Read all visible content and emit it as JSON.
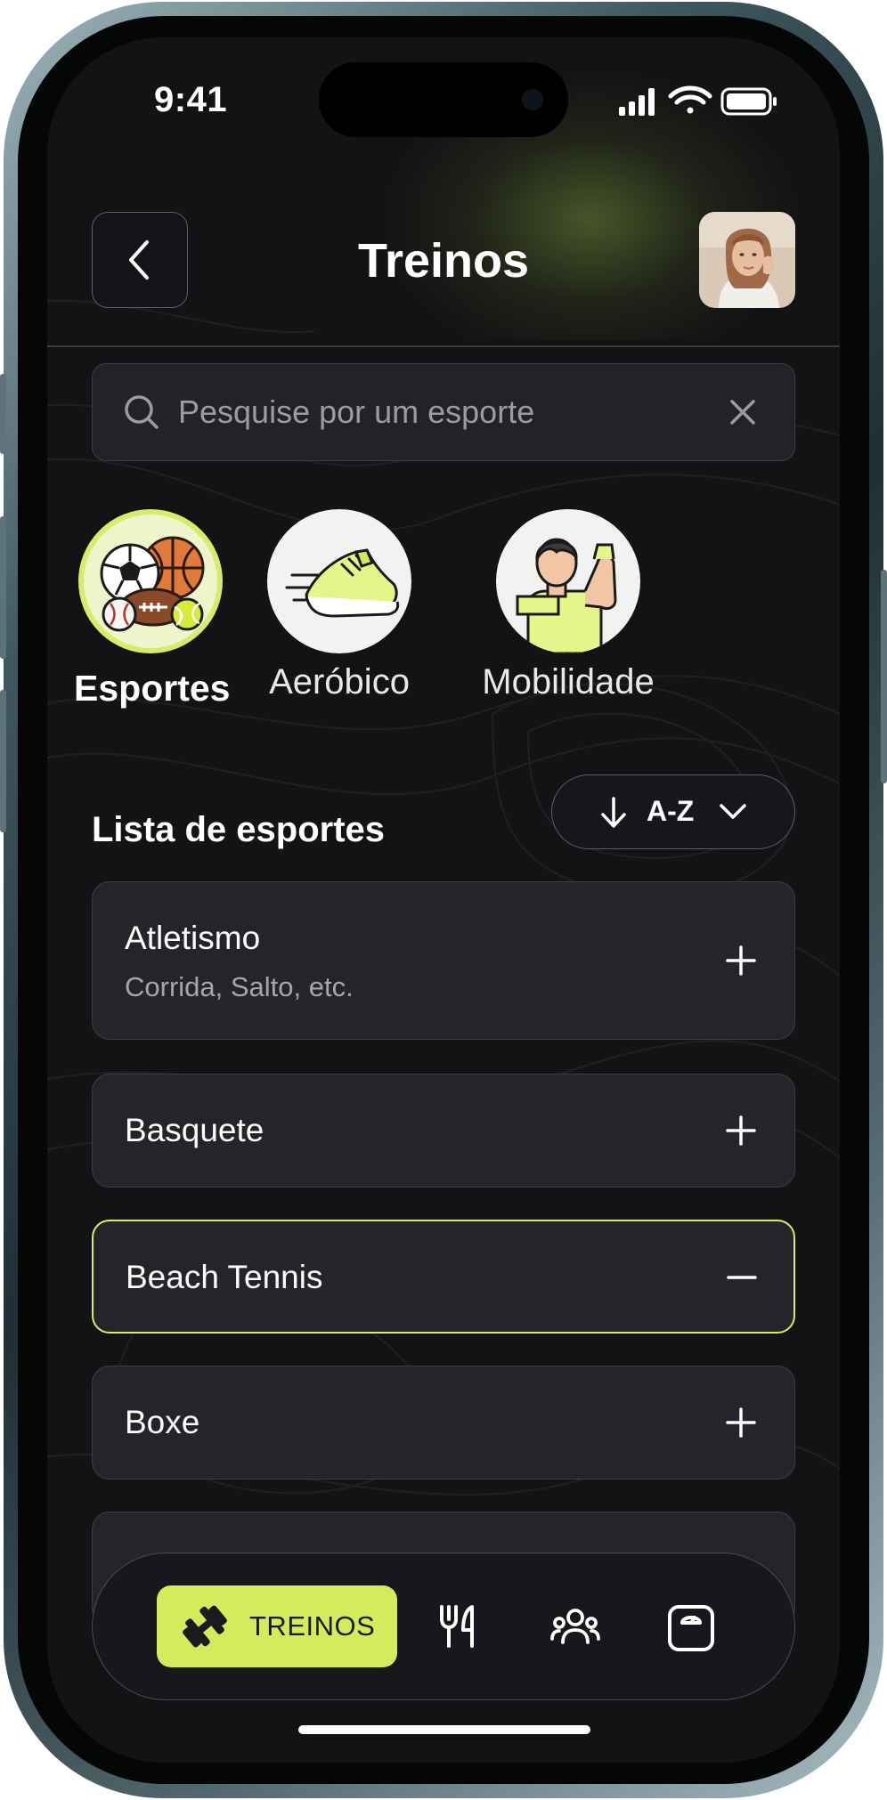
{
  "status_bar": {
    "time": "9:41"
  },
  "header": {
    "title": "Treinos",
    "back_icon": "chevron-left-icon",
    "avatar": "user-avatar-photo"
  },
  "search": {
    "placeholder": "Pesquise por um esporte",
    "value": "",
    "icon": "search-icon",
    "clear_icon": "close-icon"
  },
  "categories": [
    {
      "label": "Esportes",
      "icon": "sports-balls-icon",
      "active": true
    },
    {
      "label": "Aeróbico",
      "icon": "running-shoe-icon",
      "active": false
    },
    {
      "label": "Mobilidade",
      "icon": "stretching-person-icon",
      "active": false
    }
  ],
  "list": {
    "title": "Lista de esportes",
    "sort_label": "A-Z",
    "items": [
      {
        "name": "Atletismo",
        "subtitle": "Corrida, Salto, etc.",
        "action": "plus-icon",
        "selected": false
      },
      {
        "name": "Basquete",
        "action": "plus-icon",
        "selected": false
      },
      {
        "name": "Beach Tennis",
        "action": "minus-icon",
        "selected": true
      },
      {
        "name": "Boxe",
        "action": "plus-icon",
        "selected": false
      }
    ]
  },
  "bottom_nav": {
    "active_label": "TREINOS",
    "items": [
      "dumbbell-icon",
      "fork-knife-icon",
      "community-icon",
      "scale-icon"
    ]
  },
  "colors": {
    "accent": "#d3ec5c",
    "background": "#121315",
    "card": "#242528",
    "selected_border": "#d6ec6a"
  }
}
